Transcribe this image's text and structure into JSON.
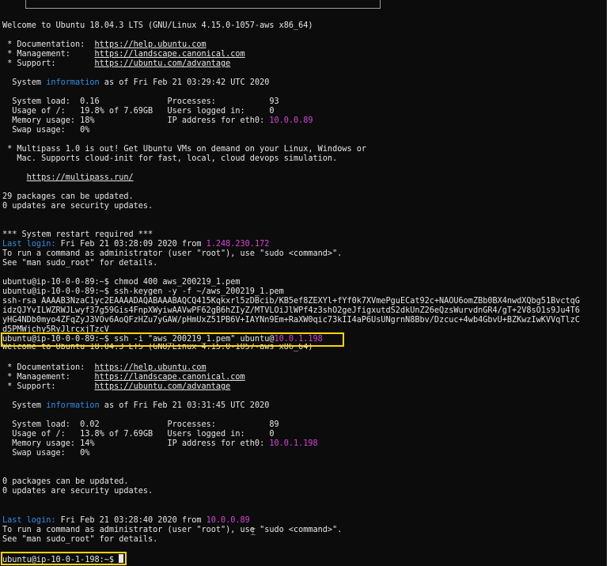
{
  "terminal": {
    "session1": {
      "welcome": "Welcome to Ubuntu 18.04.3 LTS (GNU/Linux 4.15.0-1057-aws x86_64)",
      "doc_label": " * Documentation:  ",
      "doc_url": "https://help.ubuntu.com",
      "mgmt_label": " * Management:     ",
      "mgmt_url": "https://landscape.canonical.com",
      "support_label": " * Support:        ",
      "support_url": "https://ubuntu.com/advantage",
      "sysinfo_pre": "  System ",
      "sysinfo_word": "information",
      "sysinfo_post": " as of Fri Feb 21 03:29:42 UTC 2020",
      "load": "  System load:  0.16              Processes:           93",
      "usage": "  Usage of /:   19.8% of 7.69GB   Users logged in:     0",
      "mem_pre": "  Memory usage: 18%               IP address for eth0: ",
      "mem_ip": "10.0.0.89",
      "swap": "  Swap usage:   0%",
      "multipass1": " * Multipass 1.0 is out! Get Ubuntu VMs on demand on your Linux, Windows or",
      "multipass2": "   Mac. Supports cloud-init for fast, local, cloud devops simulation.",
      "multipass_pre": "     ",
      "multipass_url": "https://multipass.run/",
      "packages": "29 packages can be updated.",
      "security": "0 updates are security updates.",
      "restart": "*** System restart required ***",
      "lastlogin_label": "Last login:",
      "lastlogin_text": " Fri Feb 21 03:28:09 2020 from ",
      "lastlogin_ip": "1.248.230.172",
      "admin1": "To run a command as administrator (user \"root\"), use \"sudo <command>\".",
      "admin2": "See \"man sudo_root\" for details."
    },
    "commands": {
      "chmod": "ubuntu@ip-10-0-0-89:~$ chmod 400 aws_200219_1.pem",
      "keygen": "ubuntu@ip-10-0-0-89:~$ ssh-keygen -y -f ~/aws_200219_1.pem",
      "key1": "ssh-rsa AAAAB3NzaC1yc2EAAAADAQABAAABAQCQ415Kqkxrl5zDBcib/KB5ef8ZEXYl+fYf0k7XVmePguECat92c+NAOU6omZBb0BX4nwdXQbg51BvctqG",
      "key2": "idzQJYvILWZRWJLwyf37g59Gis4FnpXWyiwAAVwPF62gB6hZIyZ/MTVLOiJlWPf4z3shO2geJfigxutdS2dkUnZ26eQzsWurvdnGR4/gT+2V8sO1s9Ju4T6",
      "key3": "yHG4NDb0myo4ZFqZyJ3VOv6AoQFzHZu7yGAW/pHmUxZ51PB6V+IAYNn9Em+RaXW0qic73kII4aP6UsUNgrnN8Bbv/Dzcuc+4wb4GbvU+BZKwzIwKVVqTlzC",
      "key4": "d5PMWjchy5RyJlrcxjTzcV",
      "ssh_pre": "ubuntu@ip-10-0-0-89:~$ ssh -i \"aws_200219_1.pem\" ubuntu@",
      "ssh_ip": "10.0.1.198"
    },
    "session2": {
      "welcome": "Welcome to Ubuntu 18.04.3 LTS (GNU/Linux 4.15.0-1057-aws x86_64)",
      "doc_label": " * Documentation:  ",
      "doc_url": "https://help.ubuntu.com",
      "mgmt_label": " * Management:     ",
      "mgmt_url": "https://landscape.canonical.com",
      "support_label": " * Support:        ",
      "support_url": "https://ubuntu.com/advantage",
      "sysinfo_pre": "  System ",
      "sysinfo_word": "information",
      "sysinfo_post": " as of Fri Feb 21 03:31:45 UTC 2020",
      "load": "  System load:  0.02              Processes:           89",
      "usage": "  Usage of /:   13.8% of 7.69GB   Users logged in:     0",
      "mem_pre": "  Memory usage: 14%               IP address for eth0: ",
      "mem_ip": "10.0.1.198",
      "swap": "  Swap usage:   0%",
      "packages": "0 packages can be updated.",
      "security": "0 updates are security updates.",
      "lastlogin_label": "Last login:",
      "lastlogin_text": " Fri Feb 21 03:28:40 2020 from ",
      "lastlogin_ip": "10.0.0.89",
      "admin1": "To run a command as administrator (user \"root\"), use \"sudo <command>\".",
      "admin2": "See \"man sudo_root\" for details.",
      "prompt": "ubuntu@ip-10-0-1-198:~$ "
    },
    "colors": {
      "background": "#0c0c0c",
      "text": "#e6e6e6",
      "keyword_blue": "#2f8fe6",
      "ip_magenta": "#d444d4",
      "highlight_yellow": "#ffd500"
    }
  }
}
